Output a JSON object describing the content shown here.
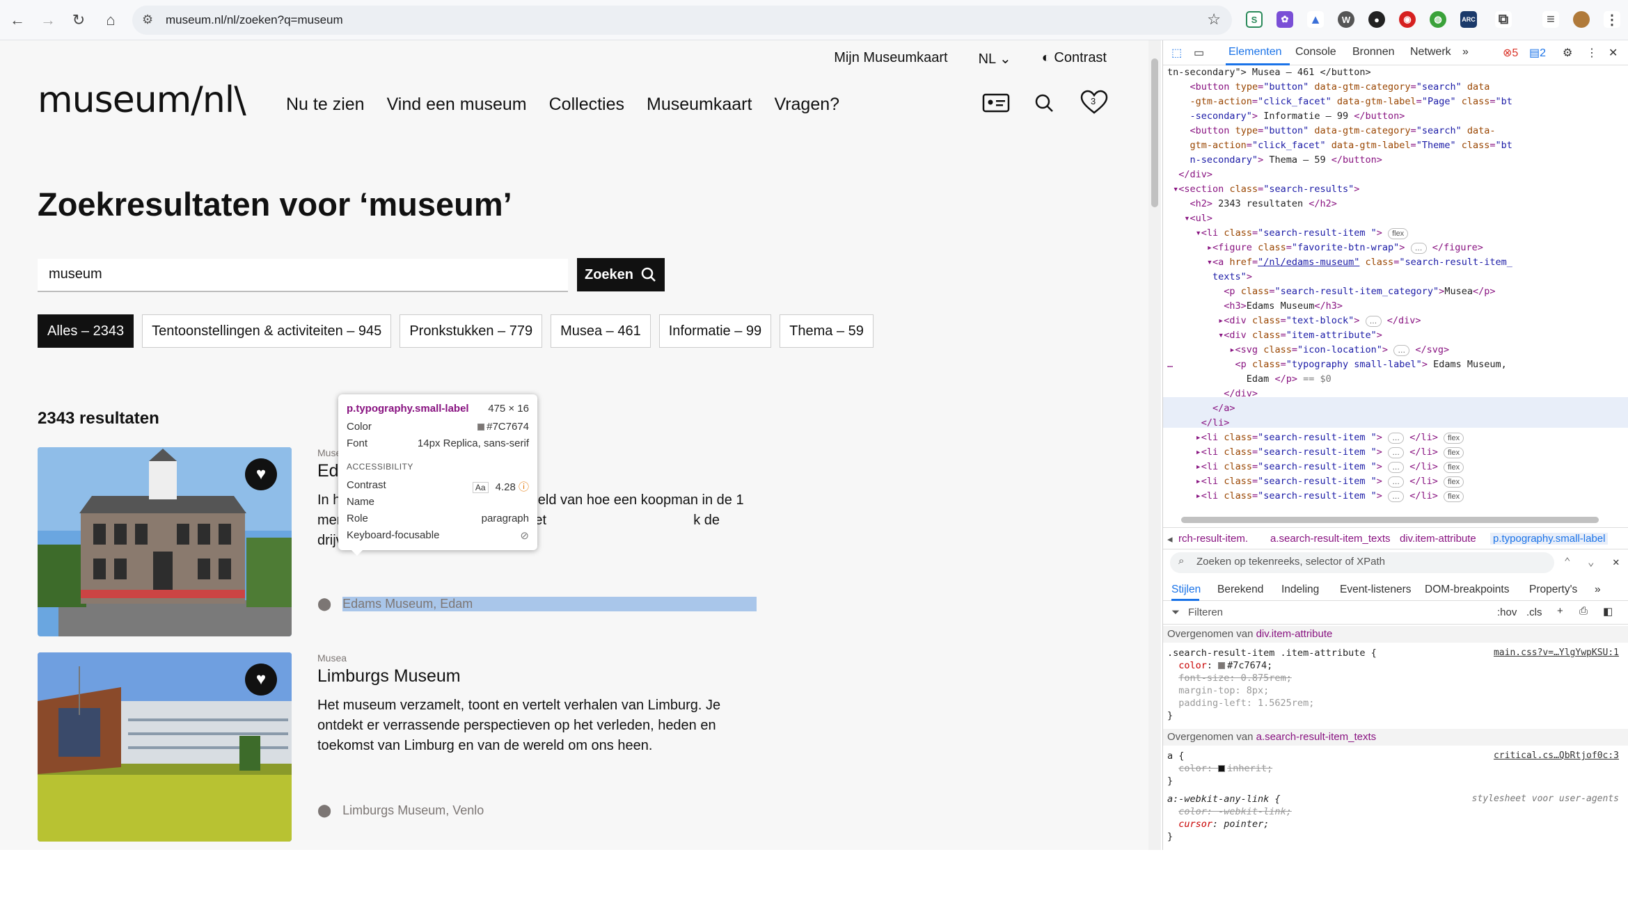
{
  "browser": {
    "url": "museum.nl/nl/zoeken?q=museum",
    "extensions": [
      "S",
      "W",
      "●",
      "A",
      "⬢",
      "CRM"
    ]
  },
  "header": {
    "util_nav": [
      "Mijn Museumkaart",
      "NL",
      "Contrast"
    ],
    "logo": "museum/nl\\",
    "main_nav": [
      "Nu te zien",
      "Vind een museum",
      "Collecties",
      "Museumkaart",
      "Vragen?"
    ],
    "favorites_count": "3"
  },
  "search": {
    "title": "Zoekresultaten voor ‘museum’",
    "query": "museum",
    "button_label": "Zoeken"
  },
  "facets": [
    {
      "label": "Alles – 2343",
      "active": true
    },
    {
      "label": "Tentoonstellingen & activiteiten – 945",
      "active": false
    },
    {
      "label": "Pronkstukken – 779",
      "active": false
    },
    {
      "label": "Musea – 461",
      "active": false
    },
    {
      "label": "Informatie – 99",
      "active": false
    },
    {
      "label": "Thema – 59",
      "active": false
    }
  ],
  "results_count": "2343 resultaten",
  "results": [
    {
      "category": "Musea",
      "title": "Edams Museum",
      "title_visible": "Eda",
      "text": "In h                                        bed beeld van hoe een koopman in de 1                                    mers in het stadhuis, het kantoor met                                      k de drijvende kelder…",
      "location": "Edams Museum, Edam"
    },
    {
      "category": "Musea",
      "title": "Limburgs Museum",
      "text": "Het museum verzamelt, toont en vertelt verhalen van Limburg. Je ontdekt er verrassende perspectieven op het verleden, heden en toekomst van Limburg en van de wereld om ons heen.",
      "location": "Limburgs Museum, Venlo"
    }
  ],
  "tooltip": {
    "selector": "p.typography.small-label",
    "size": "475 × 16",
    "color_label": "Color",
    "color_value": "#7C7674",
    "font_label": "Font",
    "font_value": "14px Replica, sans-serif",
    "accessibility_label": "ACCESSIBILITY",
    "contrast_label": "Contrast",
    "contrast_value": "4.28",
    "name_label": "Name",
    "role_label": "Role",
    "role_value": "paragraph",
    "focusable_label": "Keyboard-focusable"
  },
  "devtools": {
    "tabs": [
      "Elementen",
      "Console",
      "Bronnen",
      "Netwerk"
    ],
    "errors": "5",
    "messages": "2",
    "breadcrumbs": [
      "rch-result-item.",
      "a.search-result-item_texts",
      "div.item-attribute",
      "p.typography.small-label"
    ],
    "search_placeholder": "Zoeken op tekenreeks, selector of XPath",
    "style_tabs": [
      "Stijlen",
      "Berekend",
      "Indeling",
      "Event-listeners",
      "DOM-breakpoints",
      "Property's"
    ],
    "filter_placeholder": "Filteren",
    "filter_tools": [
      ":hov",
      ".cls"
    ],
    "inherited_1": "div.item-attribute",
    "inherited_2": "a.search-result-item_texts",
    "inherited_prefix": "Overgenomen van",
    "rule_1_selector": ".search-result-item .item-attribute {",
    "rule_1_source": "main.css?v=…YlgYwpKSU:1",
    "rule_2_source": "critical.cs…QbRtjof0c:3",
    "rule_3_selector": "a:-webkit-any-link {",
    "rule_3_source": "stylesheet voor user-agents"
  }
}
